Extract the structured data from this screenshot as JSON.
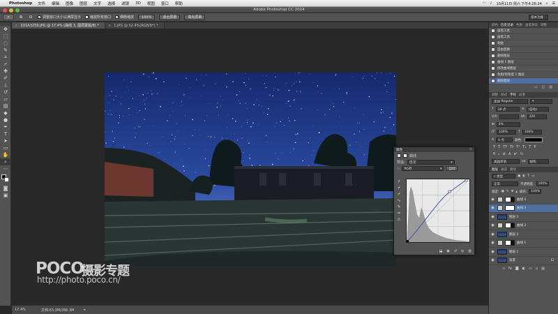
{
  "menubar": {
    "app": "Photoshop",
    "items": [
      "文件",
      "编辑",
      "图像",
      "图层",
      "文字",
      "选择",
      "滤镜",
      "3D",
      "视图",
      "窗口",
      "帮助"
    ],
    "datetime": "10月11日 周六 下午4:26:24"
  },
  "window": {
    "title": "Adobe Photoshop CC 2014"
  },
  "options": {
    "check1": "调整窗口大小以满屏显示",
    "check2": "缩放所有窗口",
    "check3": "细微缩放",
    "zoom_value": "100%",
    "fit_screen": "适合屏幕",
    "fill_screen": "填充屏幕",
    "workspace": "基本功能"
  },
  "tabs": [
    {
      "label": "1D1A3259.JPG @ 17.4% (曲线 3, 图层蒙版/8) *",
      "close": "×"
    },
    {
      "label": "1.JPG @ 52.4%(RGB/8*) *",
      "close": "×"
    }
  ],
  "status": {
    "zoom": "17.4%",
    "doc": "文档:63.3M/286.3M",
    "arrow": "▸"
  },
  "watermark": {
    "brand": "POCO",
    "cn": "摄影专题",
    "url": "http://photo.poco.cn/"
  },
  "properties": {
    "title": "属性",
    "close": "×",
    "panel_name": "曲线",
    "preset_label": "预设:",
    "preset_value": "自定",
    "channel": "RGB",
    "auto": "自动"
  },
  "history": {
    "tabs": [
      "颜色",
      "历史记录",
      "色板",
      "画笔预设",
      "调整"
    ],
    "items": [
      "画笔工具",
      "画笔工具",
      "粘贴",
      "自由变换",
      "删除图层",
      "曲线 1 图层",
      "修改曲线图层",
      "色相/饱和度 1 图层",
      "删除图层"
    ],
    "selected": 8
  },
  "character": {
    "tabs": [
      "调整",
      "样式",
      "字符",
      "段落"
    ],
    "font": "Regular",
    "font_family": "黑体",
    "size": "36 点",
    "leading": "(自动)",
    "tracking": "320",
    "kerning": "0%",
    "scale_v": "100%",
    "scale_h": "100%",
    "baseline": "0 点",
    "color_label": "颜色:",
    "lang": "美国英语",
    "aa": "锐利"
  },
  "layers": {
    "tabs": [
      "图层",
      "通道",
      "路径"
    ],
    "kind": "类型",
    "blend": "正常",
    "opacity_label": "不透明度:",
    "opacity": "100%",
    "lock_label": "锁定:",
    "fill_label": "填充:",
    "fill": "100%",
    "items": [
      {
        "name": "曲线 4",
        "type": "adj",
        "selected": false
      },
      {
        "name": "曲线 3",
        "type": "adj",
        "selected": true
      },
      {
        "name": "图层 3",
        "type": "pix",
        "selected": false
      },
      {
        "name": "曲线 2",
        "type": "adj",
        "selected": false
      },
      {
        "name": "图层 2",
        "type": "pix",
        "selected": false
      },
      {
        "name": "曲线 1",
        "type": "adj",
        "selected": false
      },
      {
        "name": "图层 1",
        "type": "pix",
        "selected": false
      },
      {
        "name": "背景",
        "type": "pix",
        "selected": false
      }
    ]
  },
  "colors": {
    "accent": "#4f6fa0",
    "panel": "#535353",
    "sky": "#2a4aa0"
  }
}
